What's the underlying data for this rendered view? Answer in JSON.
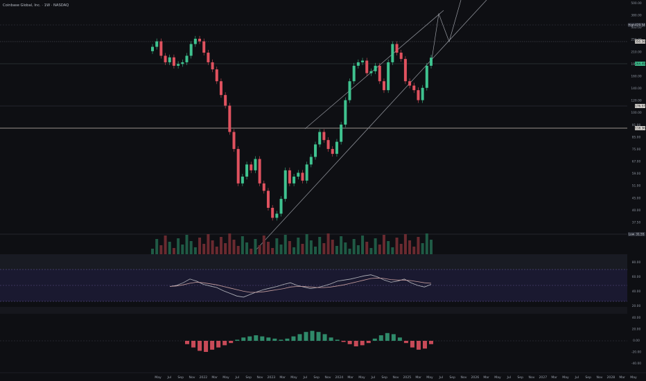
{
  "chart_data": [
    {
      "type": "candlestick",
      "title": "Coinbase Global, Inc. · 1W · NASDAQ",
      "x_axis": [
        "May",
        "Jul",
        "Sep",
        "Nov",
        "2022",
        "Mar",
        "May",
        "Jul",
        "Sep",
        "Nov",
        "2023",
        "Mar",
        "May",
        "Jul",
        "Sep",
        "Nov",
        "2024",
        "Mar",
        "May",
        "Jul",
        "Sep",
        "Nov",
        "2025",
        "Mar",
        "May",
        "Jul",
        "Sep",
        "Nov",
        "2026",
        "Mar",
        "May",
        "Jul",
        "Sep",
        "Nov",
        "2027",
        "Mar",
        "May",
        "Jul",
        "Sep",
        "Nov",
        "2028",
        "Mar",
        "May"
      ],
      "price_axis": [
        "500.00",
        "380.00",
        "300.00",
        "250.00",
        "210.00",
        "190.00",
        "160.00",
        "140.00",
        "120.00",
        "100.00",
        "91.00",
        "85.00",
        "75.00",
        "67.00",
        "59.00",
        "51.00",
        "45.00",
        "40.00",
        "37.50",
        "33.00"
      ],
      "price_tags": [
        {
          "label": "High",
          "value": "429.54"
        },
        {
          "label": "",
          "value": "350.56"
        },
        {
          "label": "",
          "value": "264.49"
        },
        {
          "label": "",
          "value": "176.57"
        },
        {
          "label": "",
          "value": "118.36"
        },
        {
          "label": "Low",
          "value": "31.55"
        }
      ],
      "series": [
        {
          "name": "COIN",
          "kind": "price",
          "close": [
            300,
            320,
            270,
            250,
            265,
            240,
            245,
            250,
            270,
            310,
            330,
            320,
            280,
            250,
            230,
            200,
            170,
            150,
            110,
            90,
            60,
            65,
            75,
            70,
            80,
            60,
            55,
            45,
            40,
            42,
            50,
            70,
            60,
            65,
            68,
            62,
            75,
            82,
            95,
            110,
            100,
            90,
            85,
            98,
            120,
            160,
            200,
            240,
            250,
            255,
            220,
            225,
            240,
            200,
            180,
            250,
            310,
            280,
            260,
            200,
            190,
            180,
            160,
            185,
            240,
            264
          ]
        }
      ]
    },
    {
      "type": "line",
      "name": "RSI",
      "y_axis": [
        "80.00",
        "60.00",
        "40.00",
        "20.00"
      ],
      "series": [
        {
          "name": "RSI",
          "values": [
            48,
            50,
            55,
            62,
            58,
            52,
            49,
            46,
            40,
            35,
            30,
            28,
            33,
            38,
            42,
            45,
            48,
            52,
            55,
            50,
            47,
            44,
            46,
            49,
            53,
            58,
            60,
            62,
            65,
            68,
            70,
            66,
            60,
            56,
            58,
            62,
            55,
            50,
            47,
            52
          ]
        },
        {
          "name": "RSI MA",
          "values": [
            48,
            49,
            51,
            54,
            56,
            55,
            53,
            51,
            48,
            45,
            42,
            39,
            37,
            37,
            38,
            40,
            42,
            44,
            47,
            48,
            48,
            47,
            46,
            46,
            47,
            49,
            51,
            54,
            57,
            60,
            63,
            64,
            63,
            61,
            60,
            60,
            59,
            57,
            55,
            54
          ]
        }
      ]
    },
    {
      "type": "bar",
      "name": "MACD",
      "y_axis": [
        "40.00",
        "20.00",
        "0.00",
        "-20.00",
        "-40.00"
      ],
      "series": [
        {
          "name": "Histogram",
          "values": [
            -3,
            -6,
            -9,
            -10,
            -8,
            -6,
            -4,
            -2,
            1,
            3,
            4,
            5,
            4,
            3,
            2,
            1,
            2,
            4,
            6,
            8,
            9,
            8,
            6,
            3,
            1,
            -1,
            -3,
            -5,
            -4,
            -2,
            2,
            5,
            7,
            6,
            3,
            -2,
            -6,
            -8,
            -7,
            -3
          ]
        }
      ]
    }
  ]
}
